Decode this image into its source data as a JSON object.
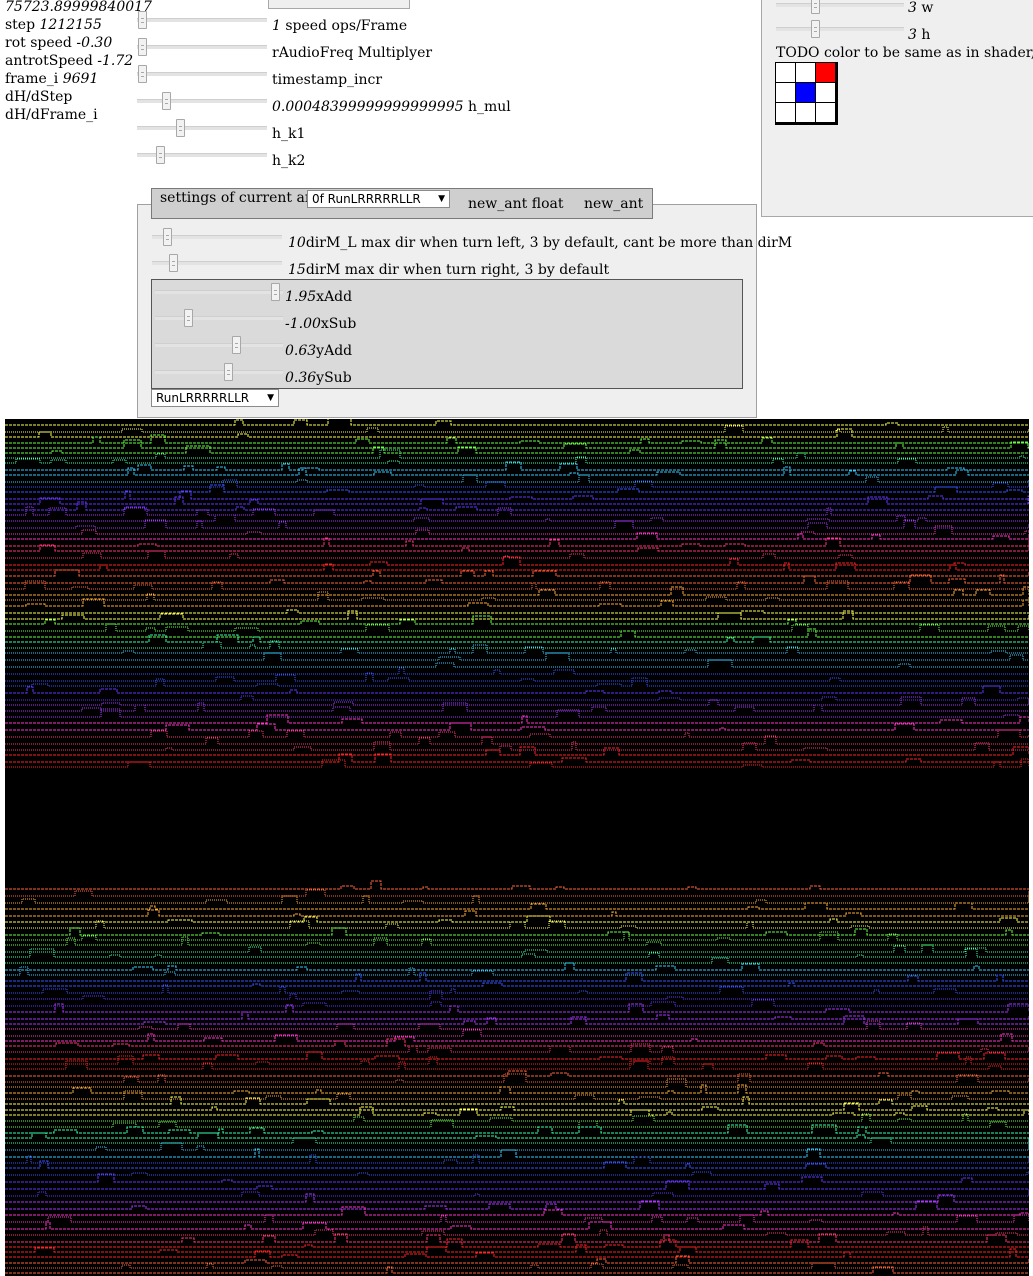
{
  "stats": {
    "timestamp": "75723.89999840017",
    "step_label": "step",
    "step_value": "1212155",
    "rot_speed_label": "rot speed",
    "rot_speed_value": "-0.30",
    "antrot_label": "antrotSpeed",
    "antrot_value": "-1.72",
    "frame_label": "frame_i",
    "frame_value": "9691",
    "dh_dstep": "dH/dStep",
    "dh_dframe": "dH/dFrame_i"
  },
  "controls": {
    "speed_value": "1",
    "speed_label": " speed ops/Frame",
    "audio_label": "rAudioFreq Multiplyer",
    "timestamp_incr_label": "timestamp_incr",
    "h_mul_value": "0.00048399999999999995",
    "h_mul_label": " h_mul",
    "h_k1_label": "h_k1",
    "h_k2_label": "h_k2"
  },
  "right_panel": {
    "w_value": "3",
    "w_label": " w",
    "h_value": "3",
    "h_label": " h",
    "todo": "TODO color to be same as in shader, sam",
    "grid_colors": [
      "#ffffff",
      "#ffffff",
      "#ff0000",
      "#ffffff",
      "#0000ff",
      "#ffffff",
      "#ffffff",
      "#ffffff",
      "#ffffff"
    ]
  },
  "ant_settings": {
    "legend_label": "settings of current ant",
    "ant_select": "0f RunLRRRRRLLR",
    "new_ant_float": "new_ant float",
    "new_ant": "new_ant",
    "dirml_value": "10",
    "dirml_label": "dirM_L max dir when turn left, 3 by default, cant be more than dirM",
    "dirm_value": "15",
    "dirm_label": "dirM max dir when turn right, 3 by default",
    "xadd_value": "1.95",
    "xadd_label": "xAdd",
    "xsub_value": "-1.00",
    "xsub_label": "xSub",
    "yadd_value": "0.63",
    "yadd_label": "yAdd",
    "ysub_value": "0.36",
    "ysub_label": "ySub",
    "rule_select": "RunLRRRRRLLR"
  },
  "canvas": {
    "palette": [
      "#ffff55",
      "#66ff44",
      "#33ffaa",
      "#33ccff",
      "#3355ff",
      "#6633ff",
      "#aa33ff",
      "#ff33cc",
      "#ff3377",
      "#ff2222",
      "#ff6633",
      "#ffaa33"
    ]
  }
}
